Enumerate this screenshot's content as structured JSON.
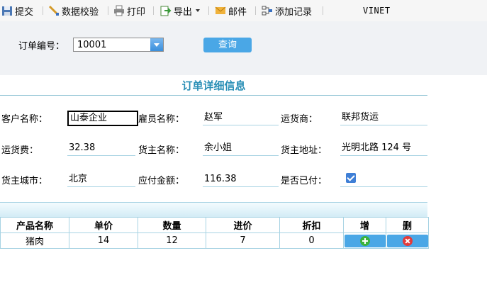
{
  "toolbar": {
    "submit": "提交",
    "validate": "数据校验",
    "print": "打印",
    "export": "导出",
    "mail": "邮件",
    "add_record": "添加记录",
    "user": "VINET"
  },
  "query": {
    "order_no_label": "订单编号：",
    "order_no_value": "10001",
    "query_button": "查询"
  },
  "form": {
    "title": "订单详细信息",
    "customer_name_label": "客户名称：",
    "customer_name": "山泰企业",
    "employee_name_label": "雇员名称：",
    "employee_name": "赵军",
    "shipper_label": "运货商：",
    "shipper": "联邦货运",
    "freight_label": "运货费：",
    "freight": "32.38",
    "consignee_name_label": "货主名称：",
    "consignee_name": "余小姐",
    "consignee_address_label": "货主地址：",
    "consignee_address": "光明北路 124 号",
    "consignee_city_label": "货主城市：",
    "consignee_city": "北京",
    "amount_due_label": "应付金额：",
    "amount_due": "116.38",
    "paid_label": "是否已付：",
    "paid": true
  },
  "grid": {
    "headers": {
      "product": "产品名称",
      "unit_price": "单价",
      "quantity": "数量",
      "cost_price": "进价",
      "discount": "折扣",
      "add": "增",
      "delete": "删"
    },
    "rows": [
      {
        "product": "猪肉",
        "unit_price": "14",
        "quantity": "12",
        "cost_price": "7",
        "discount": "0"
      }
    ]
  },
  "colors": {
    "accent": "#2a8fb6",
    "button": "#4aa7e6",
    "add_icon": "#3cb33c",
    "delete_icon": "#e23b3b"
  },
  "icons": [
    "submit-icon",
    "validate-icon",
    "print-icon",
    "export-icon",
    "mail-icon",
    "add-record-icon",
    "plus-icon",
    "delete-icon"
  ]
}
